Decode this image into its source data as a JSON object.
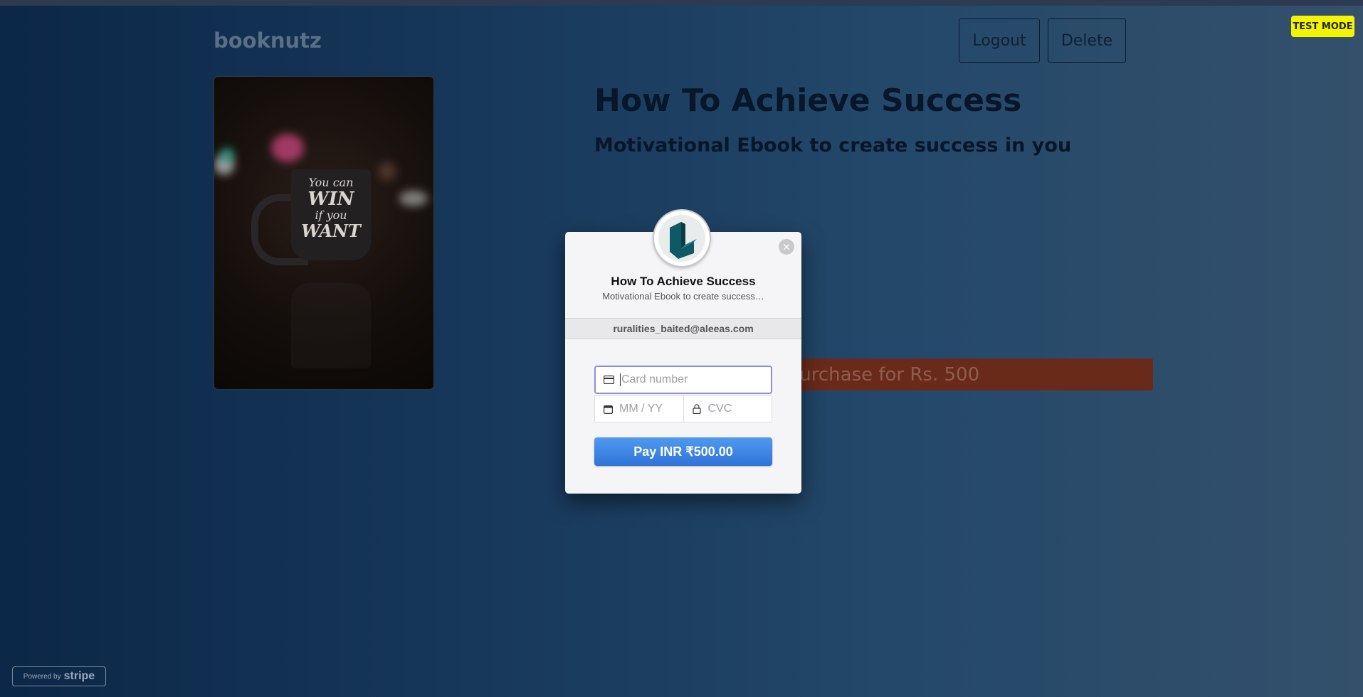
{
  "header": {
    "brand": "booknutz",
    "logout_label": "Logout",
    "delete_label": "Delete",
    "test_mode_label": "TEST MODE"
  },
  "book": {
    "title": "How To Achieve Success",
    "subtitle": "Motivational Ebook to create success in you",
    "purchase_label": "Purchase for Rs. 500",
    "cover_text": [
      "You can",
      "WIN",
      "if you",
      "WANT"
    ]
  },
  "checkout": {
    "title": "How To Achieve Success",
    "subtitle": "Motivational Ebook to create success…",
    "email": "ruralities_baited@aleeas.com",
    "card_placeholder": "Card number",
    "expiry_placeholder": "MM / YY",
    "cvc_placeholder": "CVC",
    "pay_label": "Pay INR ₹500.00",
    "close_glyph": "×"
  },
  "footer": {
    "powered_by": "Powered by",
    "stripe": "stripe"
  },
  "colors": {
    "accent_button": "#3f87e6",
    "test_mode": "#f4f400",
    "purchase_button": "#6a2a1a"
  },
  "icons": [
    "card-icon",
    "calendar-icon",
    "lock-icon",
    "close-icon",
    "merchant-logo"
  ]
}
